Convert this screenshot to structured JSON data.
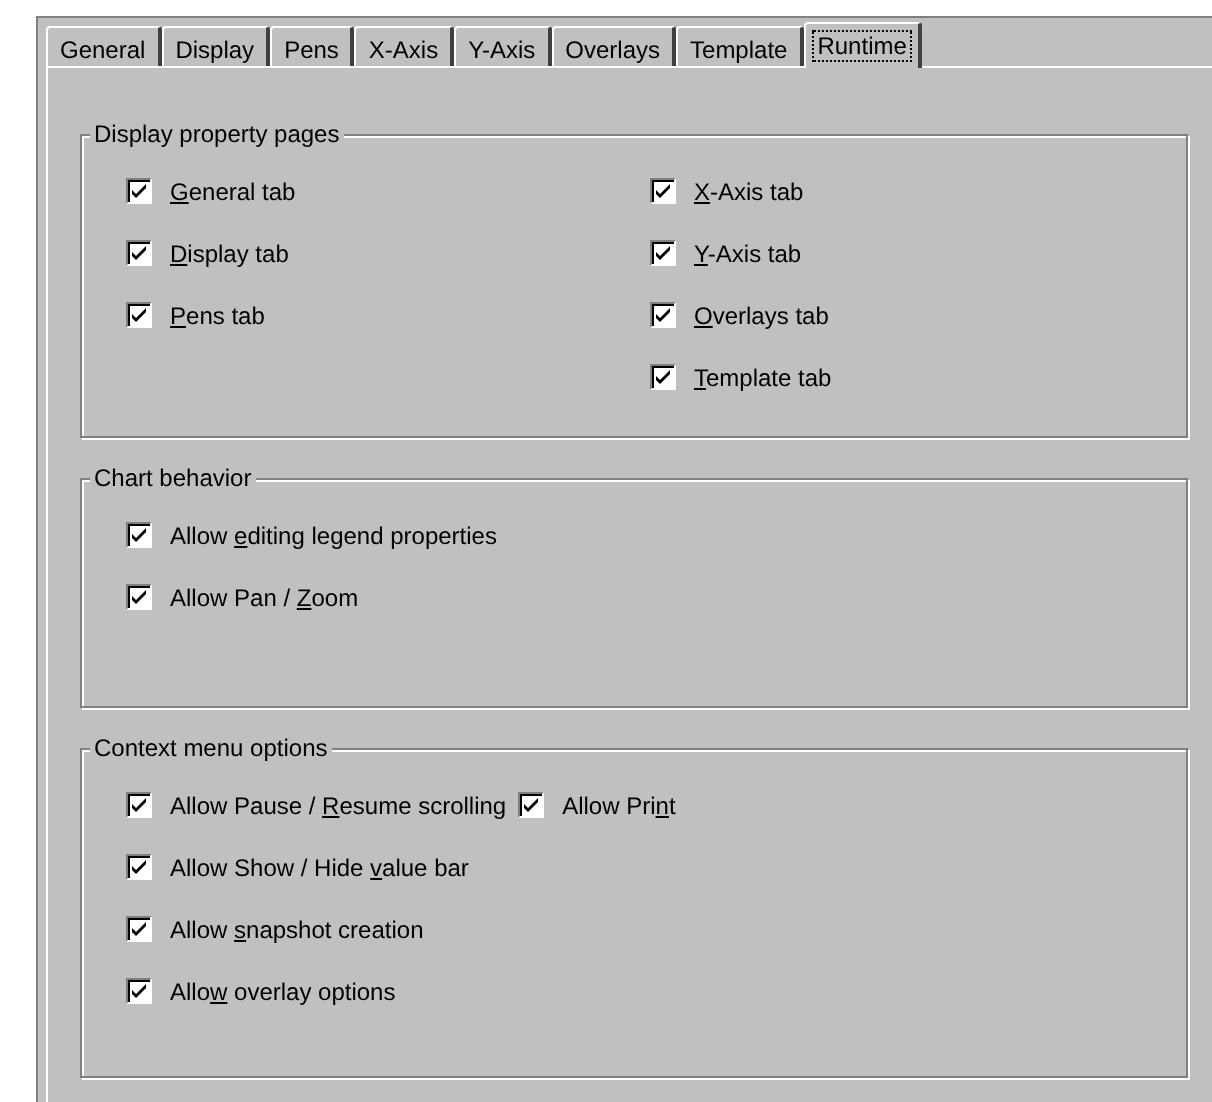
{
  "tabs": [
    {
      "label": "General",
      "selected": false
    },
    {
      "label": "Display",
      "selected": false
    },
    {
      "label": "Pens",
      "selected": false
    },
    {
      "label": "X-Axis",
      "selected": false
    },
    {
      "label": "Y-Axis",
      "selected": false
    },
    {
      "label": "Overlays",
      "selected": false
    },
    {
      "label": "Template",
      "selected": false
    },
    {
      "label": "Runtime",
      "selected": true
    }
  ],
  "groups": [
    {
      "title": "Display property pages",
      "columns": [
        [
          {
            "label": {
              "key": "G",
              "post": "eneral tab"
            },
            "checked": true
          },
          {
            "label": {
              "key": "D",
              "post": "isplay tab"
            },
            "checked": true
          },
          {
            "label": {
              "key": "P",
              "post": "ens tab"
            },
            "checked": true
          }
        ],
        [
          {
            "label": {
              "key": "X",
              "post": "-Axis tab"
            },
            "checked": true
          },
          {
            "label": {
              "key": "Y",
              "post": "-Axis tab"
            },
            "checked": true
          },
          {
            "label": {
              "key": "O",
              "post": "verlays tab"
            },
            "checked": true
          },
          {
            "label": {
              "key": "T",
              "post": "emplate tab"
            },
            "checked": true
          }
        ]
      ]
    },
    {
      "title": "Chart behavior",
      "columns": [
        [
          {
            "label": {
              "pre": "Allow ",
              "key": "e",
              "post": "diting legend properties"
            },
            "checked": true
          },
          {
            "label": {
              "pre": "Allow Pan / ",
              "key": "Z",
              "post": "oom"
            },
            "checked": true
          }
        ]
      ]
    },
    {
      "title": "Context menu options",
      "columns": [
        [
          {
            "label": {
              "pre": "Allow Pause / ",
              "key": "R",
              "post": "esume scrolling"
            },
            "checked": true
          },
          {
            "label": {
              "pre": "Allow Show / Hide ",
              "key": "v",
              "post": "alue bar"
            },
            "checked": true
          },
          {
            "label": {
              "pre": "Allow ",
              "key": "s",
              "post": "napshot creation"
            },
            "checked": true
          },
          {
            "label": {
              "pre": "Allo",
              "key": "w",
              "post": " overlay options"
            },
            "checked": true
          }
        ],
        [
          {
            "label": {
              "pre": "Allow Pri",
              "key": "n",
              "post": "t"
            },
            "checked": true
          }
        ]
      ]
    }
  ]
}
